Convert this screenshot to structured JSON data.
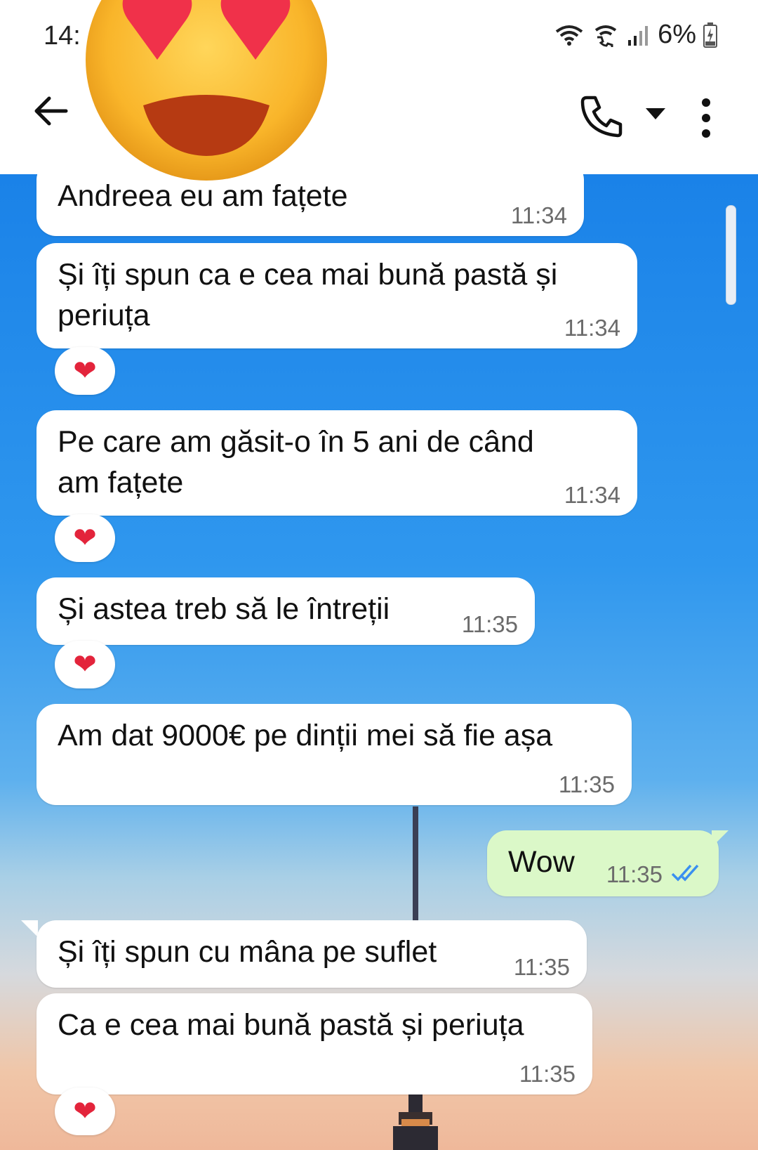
{
  "status": {
    "time": "14:",
    "battery": "6%"
  },
  "header": {
    "back_icon": "arrow-left-icon",
    "call_icon": "phone-icon",
    "dropdown_icon": "caret-down-icon",
    "menu_icon": "more-vertical-icon",
    "avatar_overlay": "heart-eyes-emoji"
  },
  "colors": {
    "incoming_bubble": "#ffffff",
    "outgoing_bubble": "#dbf8c8",
    "read_ticks": "#3a8ff0",
    "reaction_heart": "#e3243b"
  },
  "messages": [
    {
      "text": "Andreea eu am fațete",
      "time": "11:34",
      "direction": "in"
    },
    {
      "text": "Și îți spun ca e cea mai bună pastă și\nperiuța",
      "time": "11:34",
      "direction": "in",
      "reaction": "❤"
    },
    {
      "text": "Pe care am găsit-o în 5 ani de când\nam fațete",
      "time": "11:34",
      "direction": "in",
      "reaction": "❤"
    },
    {
      "text": "Și astea treb să le întreții",
      "time": "11:35",
      "direction": "in",
      "reaction": "❤"
    },
    {
      "text": "Am dat 9000€ pe dinții mei să fie așa",
      "time": "11:35",
      "direction": "in"
    },
    {
      "text": "Wow",
      "time": "11:35",
      "direction": "out",
      "status": "read"
    },
    {
      "text": "Și îți spun cu mâna pe suflet",
      "time": "11:35",
      "direction": "in"
    },
    {
      "text": "Ca e cea mai bună pastă și periuța",
      "time": "11:35",
      "direction": "in",
      "reaction": "❤"
    }
  ]
}
